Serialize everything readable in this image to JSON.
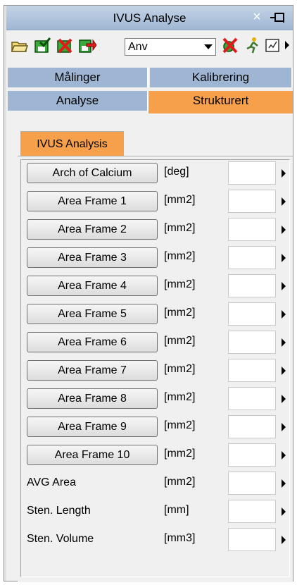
{
  "window": {
    "title": "IVUS Analyse",
    "close_glyph": "×"
  },
  "toolbar": {
    "icons": [
      "open-folder-icon",
      "save-green-icon",
      "delete-red-icon",
      "export-icon"
    ],
    "combo_value": "Anv",
    "right_icons": [
      "red-marker-icon",
      "walk-icon",
      "edit-box-icon"
    ]
  },
  "tabs": {
    "row1": [
      {
        "label": "Målinger"
      },
      {
        "label": "Kalibrering"
      }
    ],
    "row2": [
      {
        "label": "Analyse"
      },
      {
        "label": "Strukturert",
        "active": true
      }
    ]
  },
  "subtab": {
    "label": "IVUS Analysis"
  },
  "rows": [
    {
      "button": "Arch of Calcium",
      "unit": "[deg]"
    },
    {
      "button": "Area Frame 1",
      "unit": "[mm2]"
    },
    {
      "button": "Area Frame 2",
      "unit": "[mm2]"
    },
    {
      "button": "Area Frame 3",
      "unit": "[mm2]"
    },
    {
      "button": "Area Frame 4",
      "unit": "[mm2]"
    },
    {
      "button": "Area Frame 5",
      "unit": "[mm2]"
    },
    {
      "button": "Area Frame 6",
      "unit": "[mm2]"
    },
    {
      "button": "Area Frame 7",
      "unit": "[mm2]"
    },
    {
      "button": "Area Frame 8",
      "unit": "[mm2]"
    },
    {
      "button": "Area Frame 9",
      "unit": "[mm2]"
    },
    {
      "button": "Area Frame 10",
      "unit": "[mm2]"
    },
    {
      "label": "AVG Area",
      "unit": "[mm2]"
    },
    {
      "label": "Sten. Length",
      "unit": "[mm]"
    },
    {
      "label": "Sten. Volume",
      "unit": "[mm3]"
    }
  ],
  "colors": {
    "tab_blue": "#9eb6d3",
    "tab_orange": "#f7a04b",
    "title_gradient": "#9fb7d4"
  }
}
